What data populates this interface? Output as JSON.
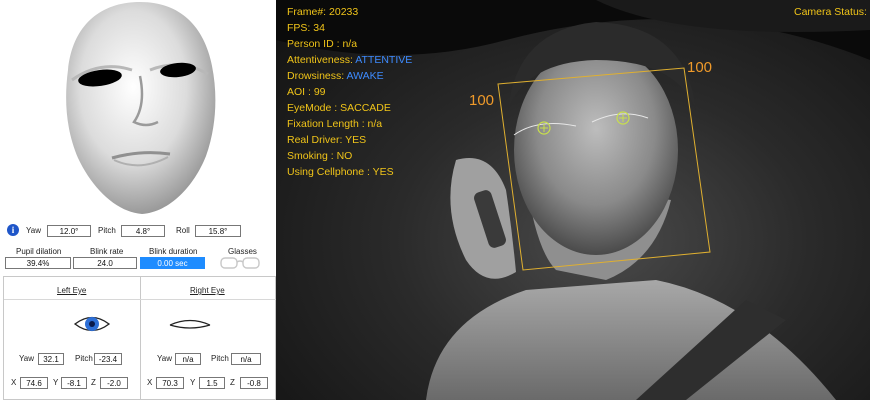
{
  "head_pose": {
    "yaw_label": "Yaw",
    "yaw": "12.0°",
    "pitch_label": "Pitch",
    "pitch": "4.8°",
    "roll_label": "Roll",
    "roll": "15.8°"
  },
  "metrics": {
    "pupil_dilation_label": "Pupil dilation",
    "pupil_dilation": "39.4%",
    "blink_rate_label": "Blink rate",
    "blink_rate": "24.0",
    "blink_duration_label": "Blink duration",
    "blink_duration": "0.00 sec",
    "glasses_label": "Glasses"
  },
  "left_eye": {
    "title": "Left  Eye",
    "yaw": "32.1",
    "pitch": "-23.4",
    "x": "74.6",
    "y": "-8.1",
    "z": "-2.0"
  },
  "right_eye": {
    "title": "Right  Eye",
    "yaw": "n/a",
    "pitch": "n/a",
    "x": "70.3",
    "y": "1.5",
    "z": "-0.8"
  },
  "eye_labels": {
    "yaw": "Yaw",
    "pitch": "Pitch",
    "x": "X",
    "y": "Y",
    "z": "Z"
  },
  "hud": {
    "frame": "Frame#:  20233",
    "fps": "FPS:  34",
    "person_id": "Person ID : n/a",
    "attentiveness_label": "Attentiveness:",
    "attentiveness_value": "ATTENTIVE",
    "drowsiness_label": "Drowsiness:",
    "drowsiness_value": "AWAKE",
    "aoi": "AOI : 99",
    "eye_mode": "EyeMode : SACCADE",
    "fixation": "Fixation Length : n/a",
    "real_driver": "Real Driver: YES",
    "smoking": "Smoking : NO",
    "cellphone": "Using Cellphone : YES",
    "camera_status": "Camera Status:",
    "box_label_top": "100",
    "box_label_left": "100"
  },
  "colors": {
    "hud_text": "#f0c419",
    "hud_value": "#3d8bff",
    "box": "#e0b030",
    "box_label": "#ef9a2a",
    "accent_field": "#1e8cff"
  },
  "icons": {
    "info": "info-icon",
    "glasses": "glasses-icon",
    "left_eye": "open-eye-icon",
    "right_eye": "closed-eye-icon"
  }
}
